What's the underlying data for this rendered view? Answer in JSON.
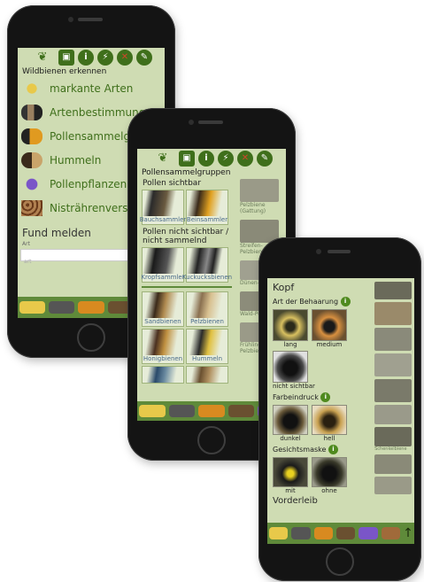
{
  "phone1": {
    "topbar_icons": [
      "bee-logo-icon",
      "book-icon",
      "info-icon",
      "lightning-icon",
      "no-pin-icon",
      "edit-icon"
    ],
    "caption": "Wildbienen erkennen",
    "menu": [
      {
        "label": "markante Arten"
      },
      {
        "label": "Artenbestimmung"
      },
      {
        "label": "Pollensammelgrup"
      },
      {
        "label": "Hummeln"
      },
      {
        "label": "Pollenpflanzen"
      },
      {
        "label": "Nistrährenverschli"
      }
    ],
    "fund_title": "Fund melden",
    "art_label": "Art",
    "art_placeholder": "art"
  },
  "phone2": {
    "caption": "Pollensammelgruppen",
    "section1": "Pollen sichtbar",
    "section2_line1": "Pollen nicht sichtbar /",
    "section2_line2": "nicht sammelnd",
    "cells": [
      {
        "label": "Bauchsammler"
      },
      {
        "label": "Beinsammler"
      },
      {
        "label": "Kropfsammler"
      },
      {
        "label": "Kuckucksbienen"
      },
      {
        "label": "Sandbienen"
      },
      {
        "label": "Pelzbienen"
      },
      {
        "label": "Honigbienen"
      },
      {
        "label": "Hummeln"
      }
    ],
    "side_captions": [
      "Pelzbiene (Gattung)",
      "Streifen-Pelzbiene",
      "Dünen-",
      "Wald-Pel",
      "Frühling-Pelzbien"
    ]
  },
  "phone3": {
    "kopf": "Kopf",
    "behaarung": "Art der Behaarung",
    "hair": [
      {
        "label": "lang"
      },
      {
        "label": "medium"
      },
      {
        "label": "nicht sichtbar"
      }
    ],
    "farbe": "Farbeindruck",
    "color_opts": [
      {
        "label": "dunkel"
      },
      {
        "label": "hell"
      }
    ],
    "maske": "Gesichtsmaske",
    "mask_opts": [
      {
        "label": "mit"
      },
      {
        "label": "ohne"
      }
    ],
    "vorderleib": "Vorderleib",
    "side_caption": "Schenkelbiene"
  },
  "colors": {
    "screen_bg": "#cfdcb3",
    "accent": "#3f6f1b",
    "bar": "#5f8a3a"
  }
}
